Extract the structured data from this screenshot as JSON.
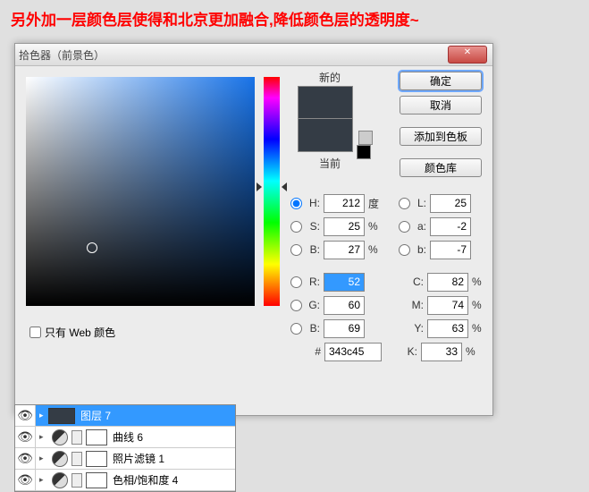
{
  "annotation": "另外加一层颜色层使得和北京更加融合,降低颜色层的透明度~",
  "dialog": {
    "title": "拾色器（前景色）",
    "close": "✕",
    "new_label": "新的",
    "current_label": "当前",
    "buttons": {
      "ok": "确定",
      "cancel": "取消",
      "add": "添加到色板",
      "lib": "颜色库"
    },
    "hsb": {
      "h_label": "H:",
      "h": "212",
      "h_unit": "度",
      "s_label": "S:",
      "s": "25",
      "s_unit": "%",
      "b_label": "B:",
      "b": "27",
      "b_unit": "%"
    },
    "lab": {
      "l_label": "L:",
      "l": "25",
      "a_label": "a:",
      "a": "-2",
      "b_label": "b:",
      "b": "-7"
    },
    "rgb": {
      "r_label": "R:",
      "r": "52",
      "g_label": "G:",
      "g": "60",
      "b_label": "B:",
      "b": "69"
    },
    "cmyk": {
      "c_label": "C:",
      "c": "82",
      "m_label": "M:",
      "m": "74",
      "y_label": "Y:",
      "y": "63",
      "k_label": "K:",
      "k": "33",
      "unit": "%"
    },
    "hex_label": "#",
    "hex": "343c45",
    "webonly": "只有 Web 颜色"
  },
  "layers": {
    "items": [
      {
        "name": "图层 7"
      },
      {
        "name": "曲线 6"
      },
      {
        "name": "照片滤镜 1"
      },
      {
        "name": "色相/饱和度 4"
      }
    ]
  }
}
